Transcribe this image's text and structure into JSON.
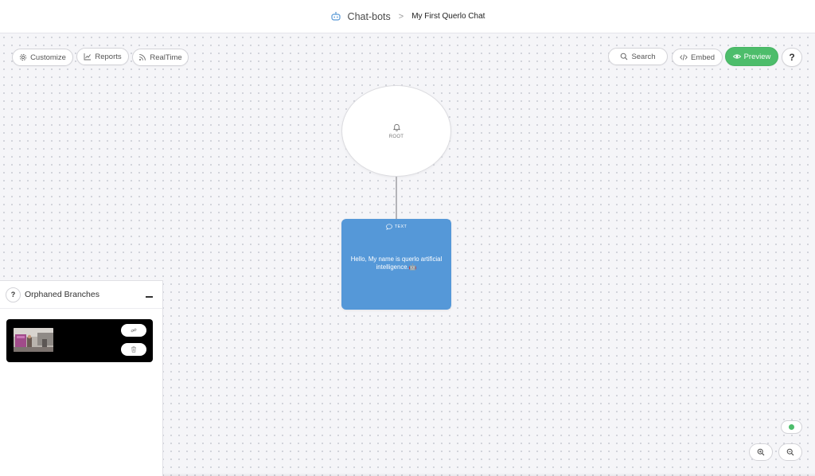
{
  "header": {
    "root_crumb": "Chat-bots",
    "separator": ">",
    "current_crumb": "My First Querlo Chat"
  },
  "toolbar": {
    "customize_label": "Customize",
    "reports_label": "Reports",
    "realtime_label": "RealTime",
    "search_label": "Search",
    "embed_label": "Embed",
    "preview_label": "Preview",
    "help_label": "?"
  },
  "flow": {
    "root_node": {
      "label": "ROOT",
      "icon": "bell-icon"
    },
    "text_node": {
      "type_label": "TEXT",
      "icon": "speech-bubble-icon",
      "message": "Hello, My name is querlo artificial intelligence.🤖"
    }
  },
  "orphan_panel": {
    "help_label": "?",
    "title": "Orphaned Branches"
  },
  "colors": {
    "preview_green": "#4dbd6b",
    "text_node_blue": "#5598d8",
    "status_green": "#4dbd6b"
  }
}
